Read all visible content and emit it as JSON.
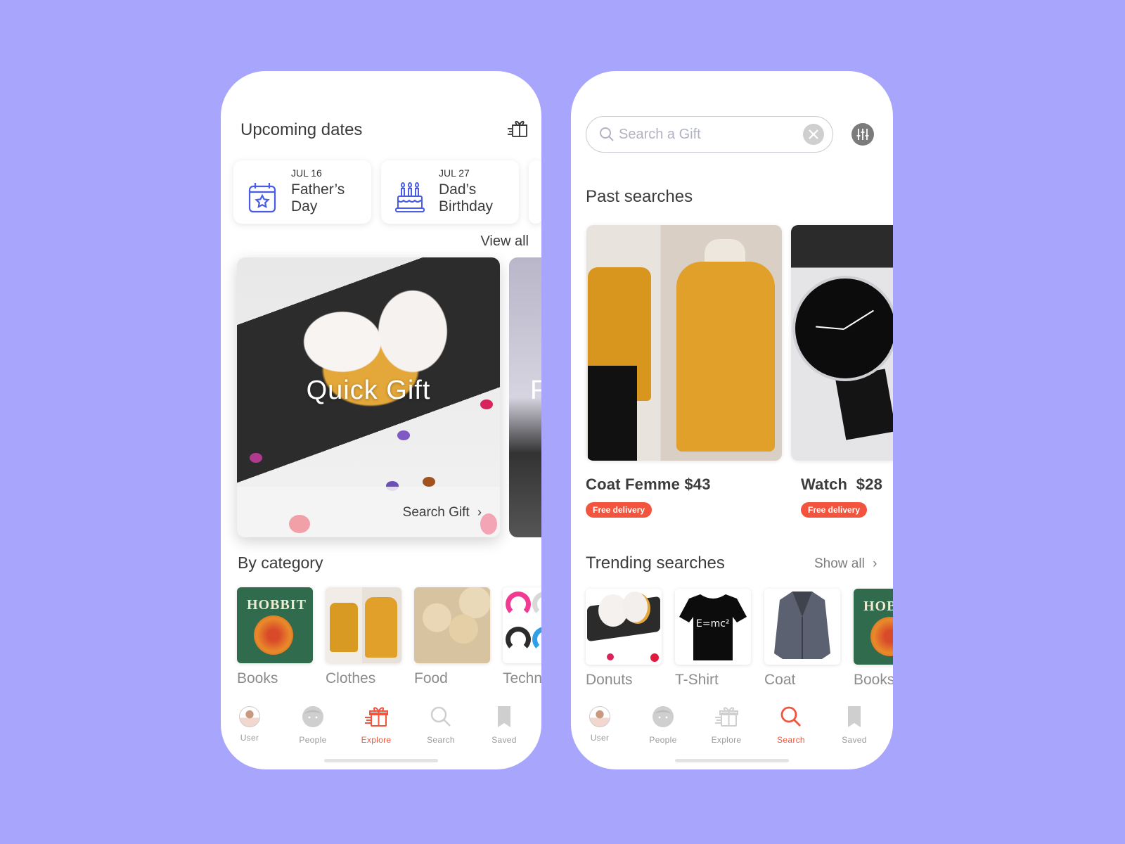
{
  "explore_screen": {
    "upcoming": {
      "title": "Upcoming dates",
      "cards": [
        {
          "date": "JUL 16",
          "name": "Father’s Day",
          "icon": "calendar-star-icon"
        },
        {
          "date": "JUL 27",
          "name": "Dad’s Birthday",
          "icon": "birthday-cake-icon"
        }
      ],
      "view_all": "View all"
    },
    "promo": {
      "title": "Quick Gift",
      "link": "Search Gift",
      "peek_letter": "F"
    },
    "categories": {
      "title": "By category",
      "items": [
        {
          "label": "Books"
        },
        {
          "label": "Clothes"
        },
        {
          "label": "Food"
        },
        {
          "label": "Techn"
        }
      ]
    },
    "tabbar": {
      "active": "Explore",
      "items": [
        {
          "label": "User",
          "icon": "user-avatar"
        },
        {
          "label": "People",
          "icon": "people-face-icon"
        },
        {
          "label": "Explore",
          "icon": "gift-fast-icon"
        },
        {
          "label": "Search",
          "icon": "search-icon"
        },
        {
          "label": "Saved",
          "icon": "bookmark-icon"
        }
      ]
    }
  },
  "search_screen": {
    "search": {
      "placeholder": "Search a Gift",
      "value": ""
    },
    "past": {
      "title": "Past searches",
      "items": [
        {
          "name": "Coat Femme $43",
          "badge": "Free delivery"
        },
        {
          "name": "Watch  $28",
          "badge": "Free delivery"
        }
      ]
    },
    "trending": {
      "title": "Trending searches",
      "show_all": "Show all",
      "items": [
        {
          "label": "Donuts"
        },
        {
          "label": "T-Shirt"
        },
        {
          "label": "Coat"
        },
        {
          "label": "Books"
        }
      ]
    },
    "tabbar": {
      "active": "Search",
      "items": [
        {
          "label": "User"
        },
        {
          "label": "People"
        },
        {
          "label": "Explore"
        },
        {
          "label": "Search"
        },
        {
          "label": "Saved"
        }
      ]
    }
  },
  "colors": {
    "background": "#a8a6fc",
    "accent": "#f2543d",
    "icon_blue": "#4a5ce6",
    "inactive": "#c9c9c9"
  }
}
